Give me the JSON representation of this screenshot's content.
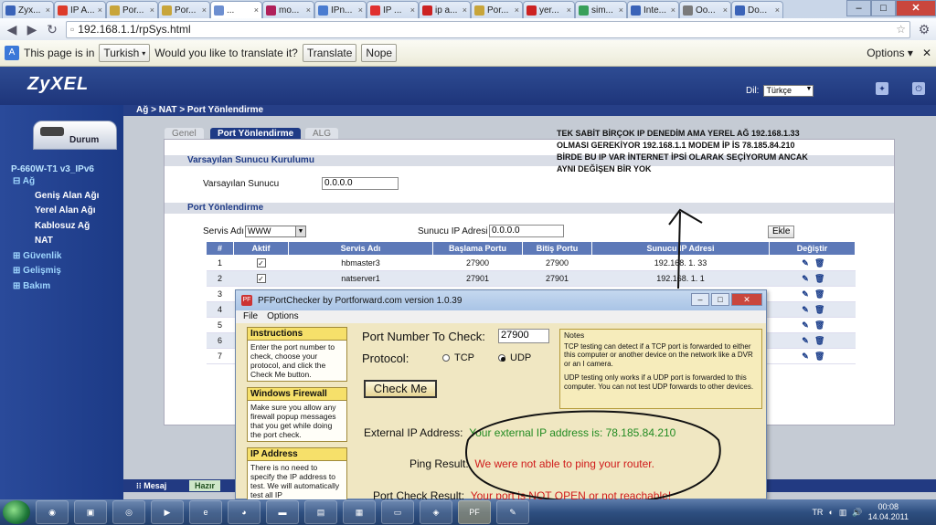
{
  "browser": {
    "tabs": [
      {
        "label": "Zyx...",
        "color": "#3a63b8"
      },
      {
        "label": "IP A...",
        "color": "#dd3b2a"
      },
      {
        "label": "Por...",
        "color": "#c8a53a"
      },
      {
        "label": "Por...",
        "color": "#c8a53a"
      },
      {
        "label": "...",
        "color": "#6d8fd0",
        "active": true
      },
      {
        "label": "mo...",
        "color": "#b0205a"
      },
      {
        "label": "IPn...",
        "color": "#4a7cd0"
      },
      {
        "label": "IP ...",
        "color": "#e03030"
      },
      {
        "label": "ip a...",
        "color": "#cc2222"
      },
      {
        "label": "Por...",
        "color": "#c8a53a"
      },
      {
        "label": "yer...",
        "color": "#cc2222"
      },
      {
        "label": "sim...",
        "color": "#38a05a"
      },
      {
        "label": "Inte...",
        "color": "#3a63b8"
      },
      {
        "label": "Oo...",
        "color": "#7a7a7a"
      },
      {
        "label": "Do...",
        "color": "#3a63b8"
      }
    ],
    "window_controls": {
      "minimize": "–",
      "maximize": "□",
      "close": "✕"
    },
    "url": "192.168.1.1/rpSys.html",
    "translate": {
      "message": "This page is in",
      "language": "Turkish",
      "question": "Would you like to translate it?",
      "translate_btn": "Translate",
      "nope_btn": "Nope",
      "options": "Options"
    }
  },
  "router": {
    "logo": "ZyXEL",
    "lang_label": "Dil:",
    "lang_value": "Türkçe",
    "breadcrumb": "Ağ > NAT > Port Yönlendirme",
    "status_tab": "Durum",
    "model": "P-660W-T1 v3_IPv6",
    "menu": {
      "ag": "Ağ",
      "wan": "Geniş Alan Ağı",
      "lan": "Yerel Alan Ağı",
      "wlan": "Kablosuz Ağ",
      "nat": "NAT",
      "security": "Güvenlik",
      "advanced": "Gelişmiş",
      "maintenance": "Bakım"
    },
    "tabs": {
      "general": "Genel",
      "port_forwarding": "Port Yönlendirme",
      "alg": "ALG"
    },
    "default_server": {
      "section": "Varsayılan Sunucu Kurulumu",
      "label": "Varsayılan Sunucu",
      "value": "0.0.0.0"
    },
    "port_forward": {
      "section": "Port Yönlendirme",
      "service_label": "Servis Adı",
      "service_value": "WWW",
      "server_ip_label": "Sunucu IP Adresi",
      "server_ip_value": "0.0.0.0",
      "add_btn": "Ekle",
      "columns": [
        "#",
        "Aktif",
        "Servis Adı",
        "Başlama Portu",
        "Bitiş Portu",
        "Sunucu IP Adresi",
        "Değiştir"
      ],
      "rows": [
        {
          "n": "1",
          "name": "hbmaster3",
          "start": "27900",
          "end": "27900",
          "ip": "192.168. 1. 33"
        },
        {
          "n": "2",
          "name": "natserver1",
          "start": "27901",
          "end": "27901",
          "ip": "192.168. 1. 1"
        },
        {
          "n": "3"
        },
        {
          "n": "4"
        },
        {
          "n": "5"
        },
        {
          "n": "6"
        },
        {
          "n": "7"
        }
      ]
    },
    "status_bar": {
      "message_label": "Mesaj",
      "ready": "Hazır"
    }
  },
  "annotation": {
    "lines": [
      "TEK SABİT BİRÇOK IP DENEDİM AMA YEREL AĞ 192.168.1.33",
      "OLMASI GEREKİYOR 192.168.1.1 MODEM İP İS 78.185.84.210",
      "BİRDE BU IP VAR İNTERNET İPSİ OLARAK SEÇİYORUM ANCAK",
      "AYNI DEĞİŞEN BİR YOK"
    ]
  },
  "pfchecker": {
    "title": "PFPortChecker by Portforward.com version 1.0.39",
    "menu": {
      "file": "File",
      "options": "Options"
    },
    "sections": {
      "instructions": {
        "title": "Instructions",
        "body": "Enter the port number to check, choose your protocol, and click the Check Me button."
      },
      "firewall": {
        "title": "Windows Firewall",
        "body": "Make sure you allow any firewall popup messages that you get while doing the port check."
      },
      "ip": {
        "title": "IP Address",
        "body": "There is no need to specify the IP address to test. We will automatically test all IP"
      }
    },
    "port_label": "Port Number To Check:",
    "port_value": "27900",
    "protocol_label": "Protocol:",
    "tcp": "TCP",
    "udp": "UDP",
    "check_btn": "Check Me",
    "notes_title": "Notes",
    "notes_1": "TCP testing can detect if a TCP port is forwarded to either this computer or another device on the network like a DVR or an I camera.",
    "notes_2": "UDP testing only works if a UDP port is forwarded to this computer. You can not test UDP forwards to other devices.",
    "external_label": "External IP Address:",
    "external_value": "Your external IP address is: 78.185.84.210",
    "ping_label": "Ping Result:",
    "ping_value": "We were not able to ping your router.",
    "portcheck_label": "Port Check Result:",
    "portcheck_value": "Your port is NOT OPEN or not reachable!"
  },
  "taskbar": {
    "lang": "TR",
    "time": "00:08",
    "date": "14.04.2011"
  }
}
